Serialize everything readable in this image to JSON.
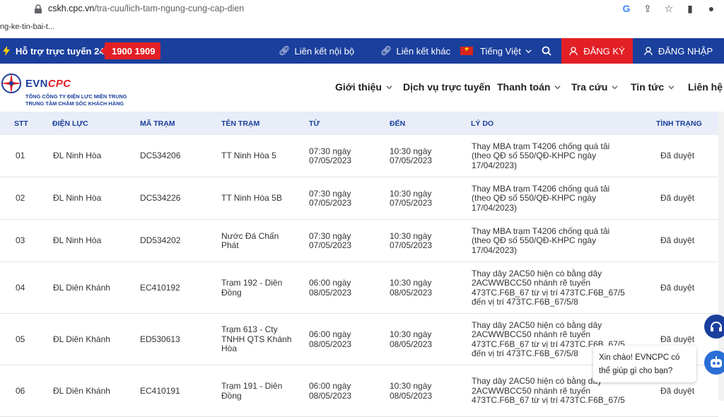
{
  "browser": {
    "url_domain": "cskh.cpc.vn",
    "url_path": "/tra-cuu/lich-tam-ngung-cung-cap-dien",
    "tab_fragment": "ng-ke-tin-bai-t..."
  },
  "topbar": {
    "support_label": "Hỗ trợ trực tuyến 24/7:",
    "hotline": "1900 1909",
    "internal_links": "Liên kết nội bộ",
    "other_links": "Liên kết khác",
    "language": "Tiếng Việt",
    "register": "ĐĂNG KÝ",
    "login": "ĐĂNG NHẬP"
  },
  "logo": {
    "evn": "EVN",
    "cpc": "CPC",
    "line1": "TỔNG CÔNG TY ĐIỆN LỰC MIỀN TRUNG",
    "line2": "TRUNG TÂM CHĂM SÓC KHÁCH HÀNG"
  },
  "nav": [
    "Giới thiệu",
    "Dịch vụ trực tuyến",
    "Thanh toán",
    "Tra cứu",
    "Tin tức",
    "Liên hệ"
  ],
  "table": {
    "headers": [
      "STT",
      "ĐIỆN LỰC",
      "MÃ TRẠM",
      "TÊN TRẠM",
      "TỪ",
      "ĐẾN",
      "LÝ DO",
      "TÌNH TRẠNG"
    ],
    "rows": [
      {
        "stt": "01",
        "dl": "ĐL Ninh Hòa",
        "ma": "DC534206",
        "ten": [
          "TT Ninh Hòa 5"
        ],
        "tu": [
          "07:30 ngày",
          "07/05/2023"
        ],
        "den": [
          "10:30 ngày",
          "07/05/2023"
        ],
        "lydo": [
          "Thay MBA trạm T4206 chống quá tải",
          "(theo QĐ số 550/QĐ-KHPC ngày",
          "17/04/2023)"
        ],
        "status": "Đã duyệt"
      },
      {
        "stt": "02",
        "dl": "ĐL Ninh Hòa",
        "ma": "DC534226",
        "ten": [
          "TT Ninh Hòa 5B"
        ],
        "tu": [
          "07:30 ngày",
          "07/05/2023"
        ],
        "den": [
          "10:30 ngày",
          "07/05/2023"
        ],
        "lydo": [
          "Thay MBA trạm T4206 chống quá tải",
          "(theo QĐ số 550/QĐ-KHPC ngày",
          "17/04/2023)"
        ],
        "status": "Đã duyệt"
      },
      {
        "stt": "03",
        "dl": "ĐL Ninh Hòa",
        "ma": "DD534202",
        "ten": [
          "Nước Đá Chấn",
          "Phát"
        ],
        "tu": [
          "07:30 ngày",
          "07/05/2023"
        ],
        "den": [
          "10:30 ngày",
          "07/05/2023"
        ],
        "lydo": [
          "Thay MBA trạm T4206 chống quá tải",
          "(theo QĐ số 550/QĐ-KHPC ngày",
          "17/04/2023)"
        ],
        "status": "Đã duyệt"
      },
      {
        "stt": "04",
        "dl": "ĐL Diên Khánh",
        "ma": "EC410192",
        "ten": [
          "Trạm 192 - Diên",
          "Đồng"
        ],
        "tu": [
          "06:00 ngày",
          "08/05/2023"
        ],
        "den": [
          "10:30 ngày",
          "08/05/2023"
        ],
        "lydo": [
          "Thay dây 2AC50 hiện có bằng dây",
          "2ACWWBCC50 nhánh rẽ tuyến",
          "473TC.F6B_67 từ vị trí 473TC.F6B_67/5",
          "đến vị trí 473TC.F6B_67/5/8"
        ],
        "status": "Đã duyệt"
      },
      {
        "stt": "05",
        "dl": "ĐL Diên Khánh",
        "ma": "ED530613",
        "ten": [
          "Trạm 613 - Cty",
          "TNHH QTS Khánh",
          "Hòa"
        ],
        "tu": [
          "06:00 ngày",
          "08/05/2023"
        ],
        "den": [
          "10:30 ngày",
          "08/05/2023"
        ],
        "lydo": [
          "Thay dây 2AC50 hiện có bằng dây",
          "2ACWWBCC50 nhánh rẽ tuyến",
          "473TC.F6B_67 từ vị trí 473TC.F6B_67/5",
          "đến vị trí 473TC.F6B_67/5/8"
        ],
        "status": "Đã duyệt"
      },
      {
        "stt": "06",
        "dl": "ĐL Diên Khánh",
        "ma": "EC410191",
        "ten": [
          "Trạm 191 - Diên",
          "Đồng"
        ],
        "tu": [
          "06:00 ngày",
          "08/05/2023"
        ],
        "den": [
          "10:30 ngày",
          "08/05/2023"
        ],
        "lydo": [
          "Thay dây 2AC50 hiện có bằng dây",
          "2ACWWBCC50 nhánh rẽ tuyến",
          "473TC.F6B_67 từ vị trí 473TC.F6B_67/5"
        ],
        "status": "Đã duyệt"
      }
    ]
  },
  "chat": {
    "line1": "Xin chào! EVNCPC có",
    "line2": "thể giúp gì cho bạn?"
  },
  "colors": {
    "brand_blue": "#1a3f9c",
    "brand_red": "#e31f26",
    "header_bg": "#e8edf8"
  }
}
